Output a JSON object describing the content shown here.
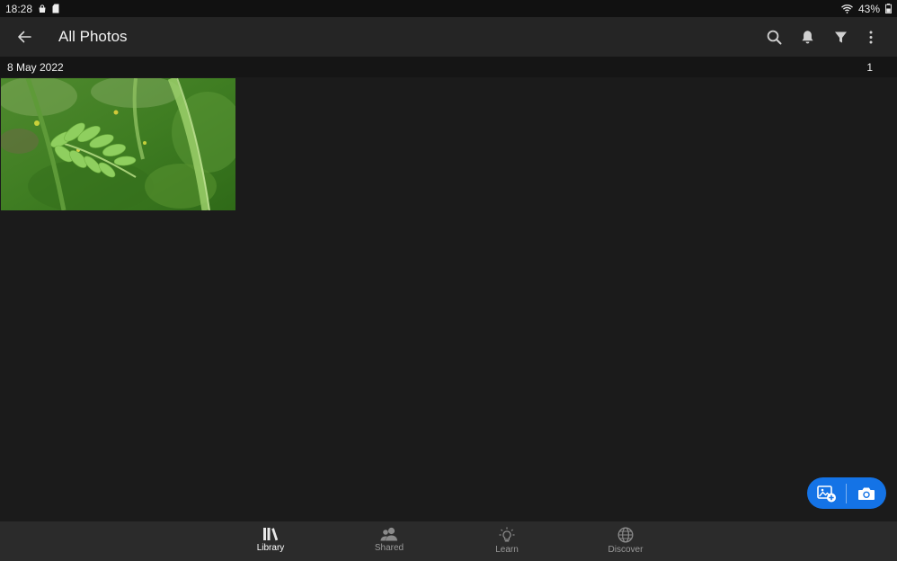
{
  "status_bar": {
    "time": "18:28",
    "battery": "43%",
    "icons": [
      "bag-notification-icon",
      "sd-card-icon",
      "wifi-icon",
      "battery-icon"
    ]
  },
  "header": {
    "title": "All Photos",
    "icons": [
      "back-arrow-icon",
      "search-icon",
      "bell-icon",
      "filter-icon",
      "more-vertical-icon"
    ]
  },
  "date_group": {
    "date": "8 May 2022",
    "count": "1"
  },
  "fab": {
    "icons": [
      "add-photo-icon",
      "camera-icon"
    ],
    "color": "#1473e6"
  },
  "bottom_nav": {
    "items": [
      {
        "label": "Library",
        "icon": "library-icon"
      },
      {
        "label": "Shared",
        "icon": "shared-icon"
      },
      {
        "label": "Learn",
        "icon": "lightbulb-icon"
      },
      {
        "label": "Discover",
        "icon": "globe-icon"
      }
    ],
    "active_index": 0
  },
  "colors": {
    "background": "#1b1b1b",
    "header": "#252525",
    "nav_bar": "#2b2b2b",
    "accent": "#1473e6"
  }
}
